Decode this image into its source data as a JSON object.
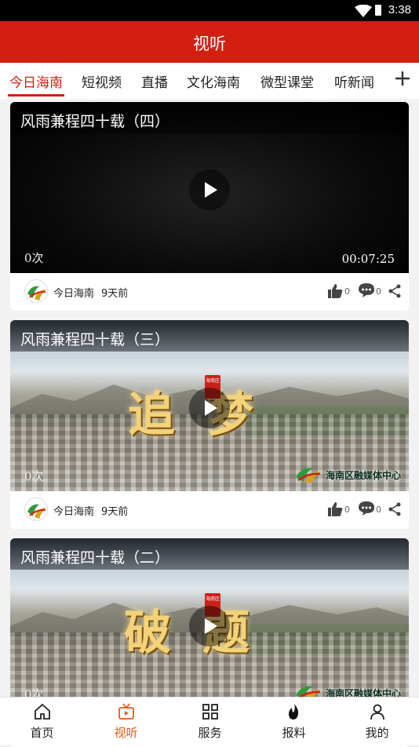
{
  "status_bar": {
    "time": "3:38"
  },
  "header": {
    "title": "视听"
  },
  "tabs": [
    {
      "label": "今日海南",
      "active": true
    },
    {
      "label": "短视频"
    },
    {
      "label": "直播"
    },
    {
      "label": "文化海南"
    },
    {
      "label": "微型课堂"
    },
    {
      "label": "听新闻"
    }
  ],
  "feed": [
    {
      "title": "风雨兼程四十载（四）",
      "views": "0次",
      "duration": "00:07:25",
      "author": "今日海南",
      "time_ago": "9天前",
      "likes": "0",
      "comments": "0"
    },
    {
      "title": "风雨兼程四十载（三）",
      "views": "0次",
      "cover_text": "追梦",
      "seal_text": "海南区",
      "logo_text": "海南区融媒体中心",
      "author": "今日海南",
      "time_ago": "9天前",
      "likes": "0",
      "comments": "0"
    },
    {
      "title": "风雨兼程四十载（二）",
      "views": "0次",
      "cover_text": "破题",
      "seal_text": "海南区",
      "logo_text": "海南区融媒体中心"
    }
  ],
  "bottom_nav": [
    {
      "label": "首页",
      "icon": "home-icon"
    },
    {
      "label": "视听",
      "icon": "tv-icon",
      "active": true
    },
    {
      "label": "服务",
      "icon": "grid-icon"
    },
    {
      "label": "报料",
      "icon": "flame-icon"
    },
    {
      "label": "我的",
      "icon": "person-icon"
    }
  ],
  "colors": {
    "brand_red": "#d21f12",
    "active_nav": "#e45a1c"
  }
}
